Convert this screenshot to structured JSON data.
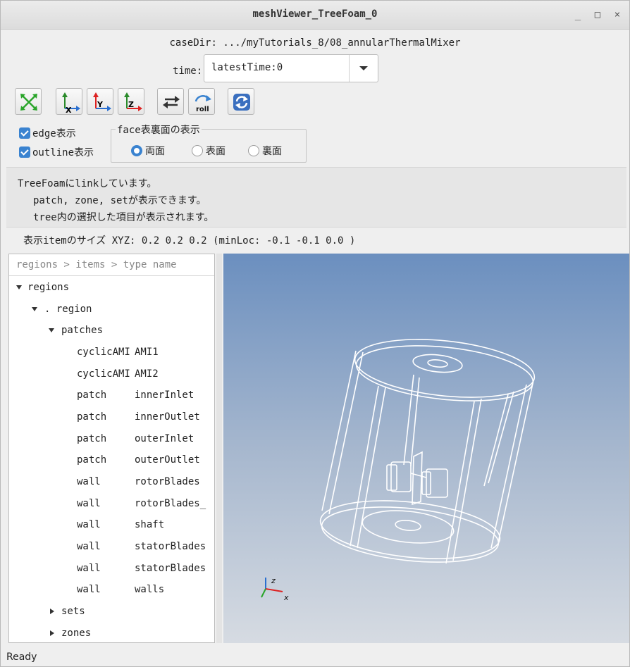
{
  "window": {
    "title": "meshViewer_TreeFoam_0",
    "minimize": "_",
    "maximize": "□",
    "close": "×"
  },
  "case_dir": "caseDir: .../myTutorials_8/08_annularThermalMixer",
  "time": {
    "label": "time:",
    "value": "latestTime:0"
  },
  "toolbar": {
    "icons": [
      "fit-all-icon",
      "view-x-icon",
      "view-y-icon",
      "view-z-icon",
      "swap-icon",
      "roll-icon",
      "reload-icon"
    ],
    "x_label": "X",
    "y_label": "Y",
    "z_label": "Z",
    "roll_label": "roll"
  },
  "options": {
    "edge": "edge表示",
    "outline": "outline表示"
  },
  "face_group": {
    "legend": "face表裏面の表示",
    "both": "両面",
    "front": "表面",
    "back": "裏面",
    "selected": "両面"
  },
  "info": [
    "TreeFoamにlinkしています。",
    "patch, zone, setが表示できます。",
    "tree内の選択した項目が表示されます。"
  ],
  "size_line": "表示itemのサイズ XYZ: 0.2 0.2 0.2  (minLoc: -0.1 -0.1 0.0 )",
  "tree": {
    "header": "regions > items > type name",
    "root": "regions",
    "region": ". region",
    "patches": "patches",
    "items": [
      {
        "type": "cyclicAMI",
        "name": "AMI1"
      },
      {
        "type": "cyclicAMI",
        "name": "AMI2"
      },
      {
        "type": "patch",
        "name": "innerInlet"
      },
      {
        "type": "patch",
        "name": "innerOutlet"
      },
      {
        "type": "patch",
        "name": "outerInlet"
      },
      {
        "type": "patch",
        "name": "outerOutlet"
      },
      {
        "type": "wall",
        "name": "rotorBlades"
      },
      {
        "type": "wall",
        "name": "rotorBlades_"
      },
      {
        "type": "wall",
        "name": "shaft"
      },
      {
        "type": "wall",
        "name": "statorBlades"
      },
      {
        "type": "wall",
        "name": "statorBlades"
      },
      {
        "type": "wall",
        "name": "walls"
      }
    ],
    "sets": "sets",
    "zones": "zones"
  },
  "axes": {
    "z": "z",
    "x": "x"
  },
  "status": "Ready"
}
